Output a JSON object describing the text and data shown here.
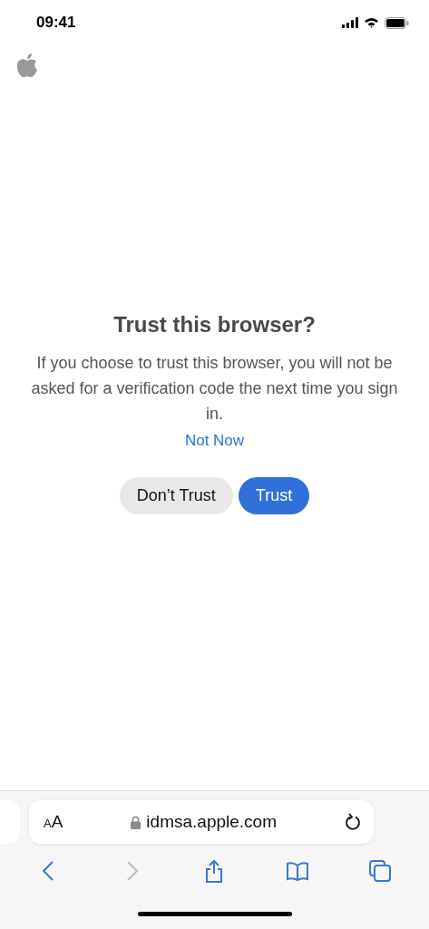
{
  "status_bar": {
    "time": "09:41"
  },
  "dialog": {
    "title": "Trust this browser?",
    "message": "If you choose to trust this browser, you will not be asked for a verification code the next time you sign in.",
    "link": "Not Now",
    "buttons": [
      {
        "label": "Don’t Trust",
        "kind": "secondary"
      },
      {
        "label": "Trust",
        "kind": "primary"
      }
    ]
  },
  "address_bar": {
    "text_size_label": "AA",
    "url": "idmsa.apple.com"
  },
  "toolbar": [
    {
      "kind": "back",
      "disabled": false
    },
    {
      "kind": "forward",
      "disabled": true
    },
    {
      "kind": "share",
      "disabled": false
    },
    {
      "kind": "bookmarks",
      "disabled": false
    },
    {
      "kind": "tabs",
      "disabled": false
    }
  ]
}
